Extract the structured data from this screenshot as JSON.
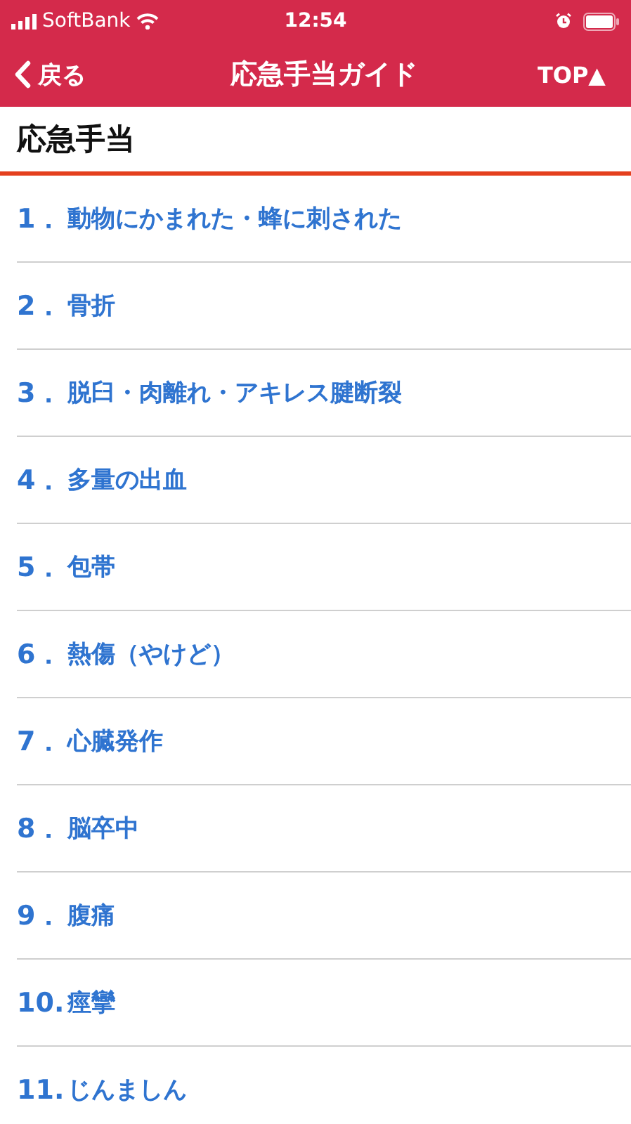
{
  "status_bar": {
    "carrier": "SoftBank",
    "time": "12:54"
  },
  "nav_bar": {
    "back": "戻る",
    "title": "応急手当ガイド",
    "top": "TOP▲"
  },
  "section": {
    "title": "応急手当"
  },
  "items": [
    {
      "number": "1．",
      "label": "動物にかまれた・蜂に刺された"
    },
    {
      "number": "2．",
      "label": "骨折"
    },
    {
      "number": "3．",
      "label": "脱臼・肉離れ・アキレス腱断裂"
    },
    {
      "number": "4．",
      "label": "多量の出血"
    },
    {
      "number": "5．",
      "label": "包帯"
    },
    {
      "number": "6．",
      "label": "熱傷（やけど）"
    },
    {
      "number": "7．",
      "label": "心臓発作"
    },
    {
      "number": "8．",
      "label": "脳卒中"
    },
    {
      "number": "9．",
      "label": "腹痛"
    },
    {
      "number": "10.",
      "label": "痙攣"
    },
    {
      "number": "11.",
      "label": "じんましん"
    }
  ]
}
